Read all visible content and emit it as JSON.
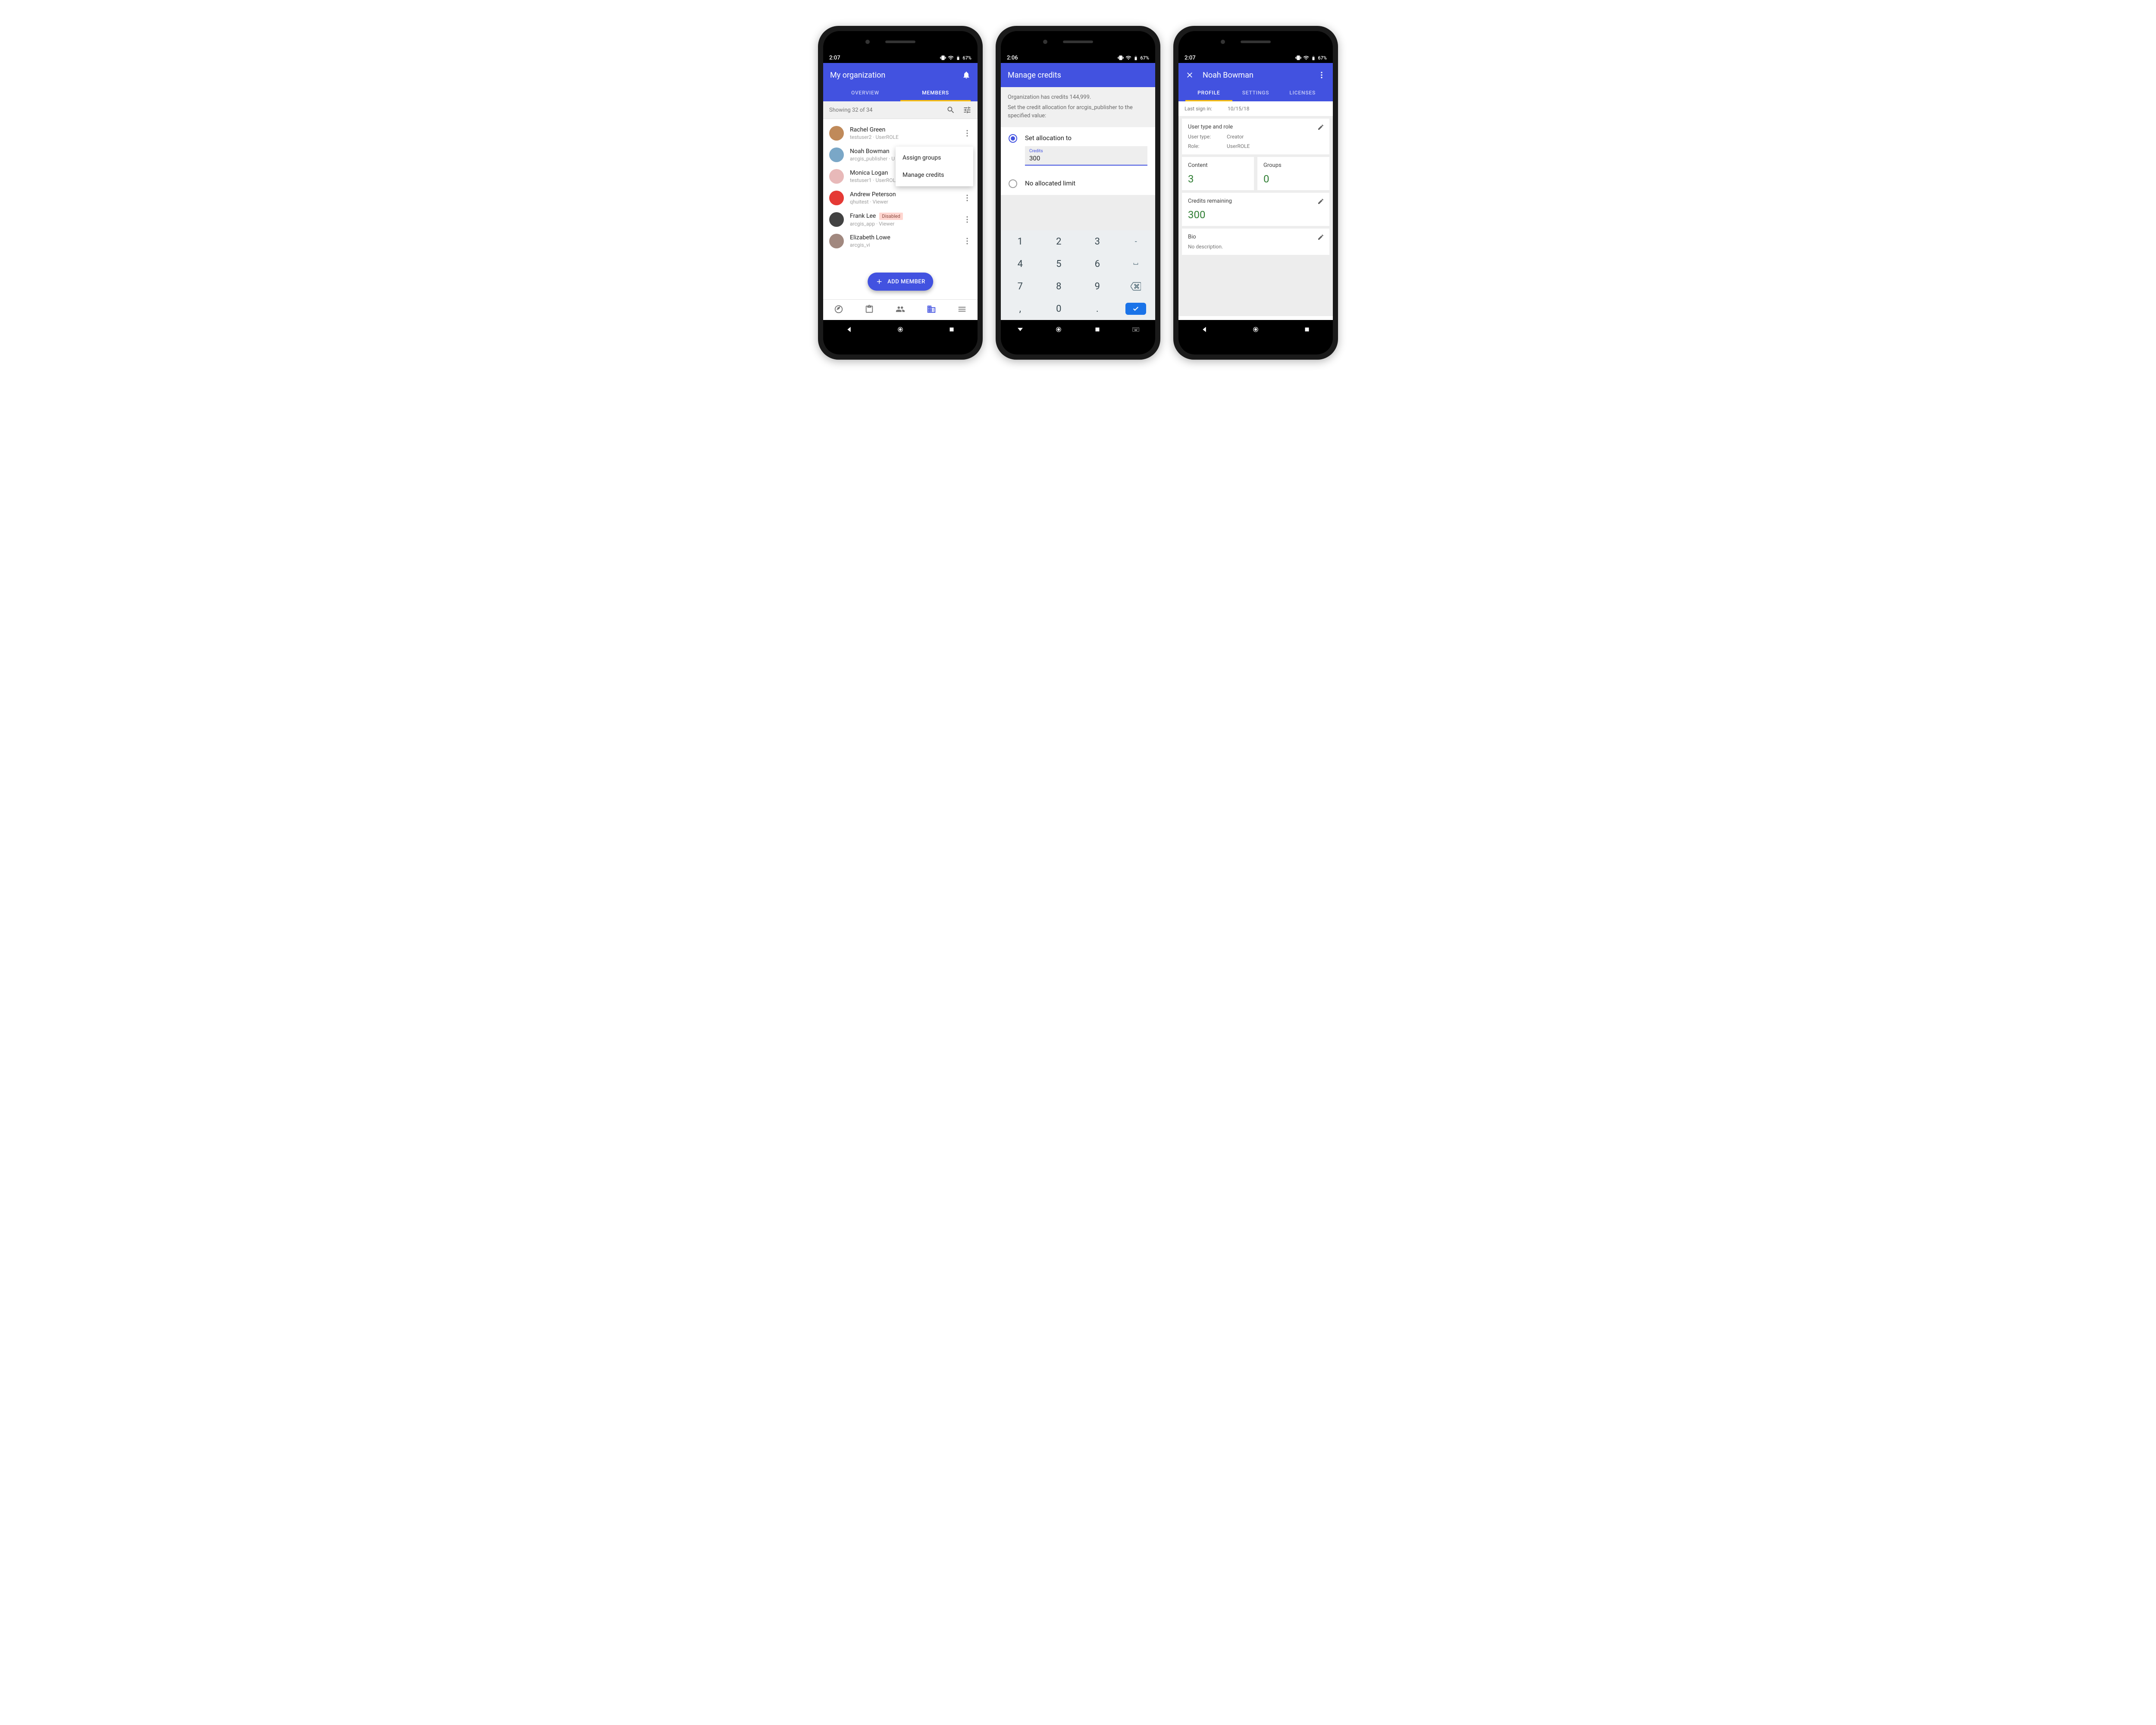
{
  "colors": {
    "primary": "#4252e0",
    "accent": "#ffc107",
    "success": "#2e7d32"
  },
  "phone1": {
    "status_time": "2:07",
    "status_battery": "67%",
    "title": "My organization",
    "tabs": [
      "OVERVIEW",
      "MEMBERS"
    ],
    "active_tab": 1,
    "showing": "Showing 32 of 34",
    "members": [
      {
        "name": "Rachel Green",
        "sub": "testuser2 · UserROLE",
        "avatar_color": "#c08a5a"
      },
      {
        "name": "Noah Bowman",
        "sub": "arcgis_publisher · U",
        "avatar_color": "#7aa7c7"
      },
      {
        "name": "Monica Logan",
        "sub": "testuser1 · UserROLE",
        "avatar_color": "#e8b9b9"
      },
      {
        "name": "Andrew Peterson",
        "sub": "qhuitest · Viewer",
        "avatar_color": "#e53935"
      },
      {
        "name": "Frank Lee",
        "sub": "arcgis_app · Viewer",
        "avatar_color": "#424242",
        "disabled": true,
        "disabled_label": "Disabled"
      },
      {
        "name": "Elizabeth Lowe",
        "sub": "arcgis_vi",
        "avatar_color": "#a1887f"
      }
    ],
    "popup": [
      "Assign groups",
      "Manage credits"
    ],
    "fab": "ADD MEMBER"
  },
  "phone2": {
    "status_time": "2:06",
    "status_battery": "67%",
    "title": "Manage credits",
    "info_line1": "Organization has credits 144,999.",
    "info_line2": "Set the credit allocation for arcgis_publisher to the specified value:",
    "option1_label": "Set allocation to",
    "credits_field_label": "Credits",
    "credits_value": "300",
    "option2_label": "No allocated limit",
    "keypad": [
      [
        "1",
        "2",
        "3",
        "-"
      ],
      [
        "4",
        "5",
        "6",
        "⌴"
      ],
      [
        "7",
        "8",
        "9",
        "⌫"
      ],
      [
        ",",
        "0",
        ".",
        "✓"
      ]
    ]
  },
  "phone3": {
    "status_time": "2:07",
    "status_battery": "67%",
    "title": "Noah Bowman",
    "tabs": [
      "PROFILE",
      "SETTINGS",
      "LICENSES"
    ],
    "active_tab": 0,
    "last_signin_label": "Last sign in:",
    "last_signin_value": "10/15/18",
    "user_type_role_title": "User type and role",
    "user_type_label": "User type:",
    "user_type_value": "Creator",
    "role_label": "Role:",
    "role_value": "UserROLE",
    "content_label": "Content",
    "content_value": "3",
    "groups_label": "Groups",
    "groups_value": "0",
    "credits_label": "Credits remaining",
    "credits_value": "300",
    "bio_label": "Bio",
    "bio_value": "No description."
  }
}
